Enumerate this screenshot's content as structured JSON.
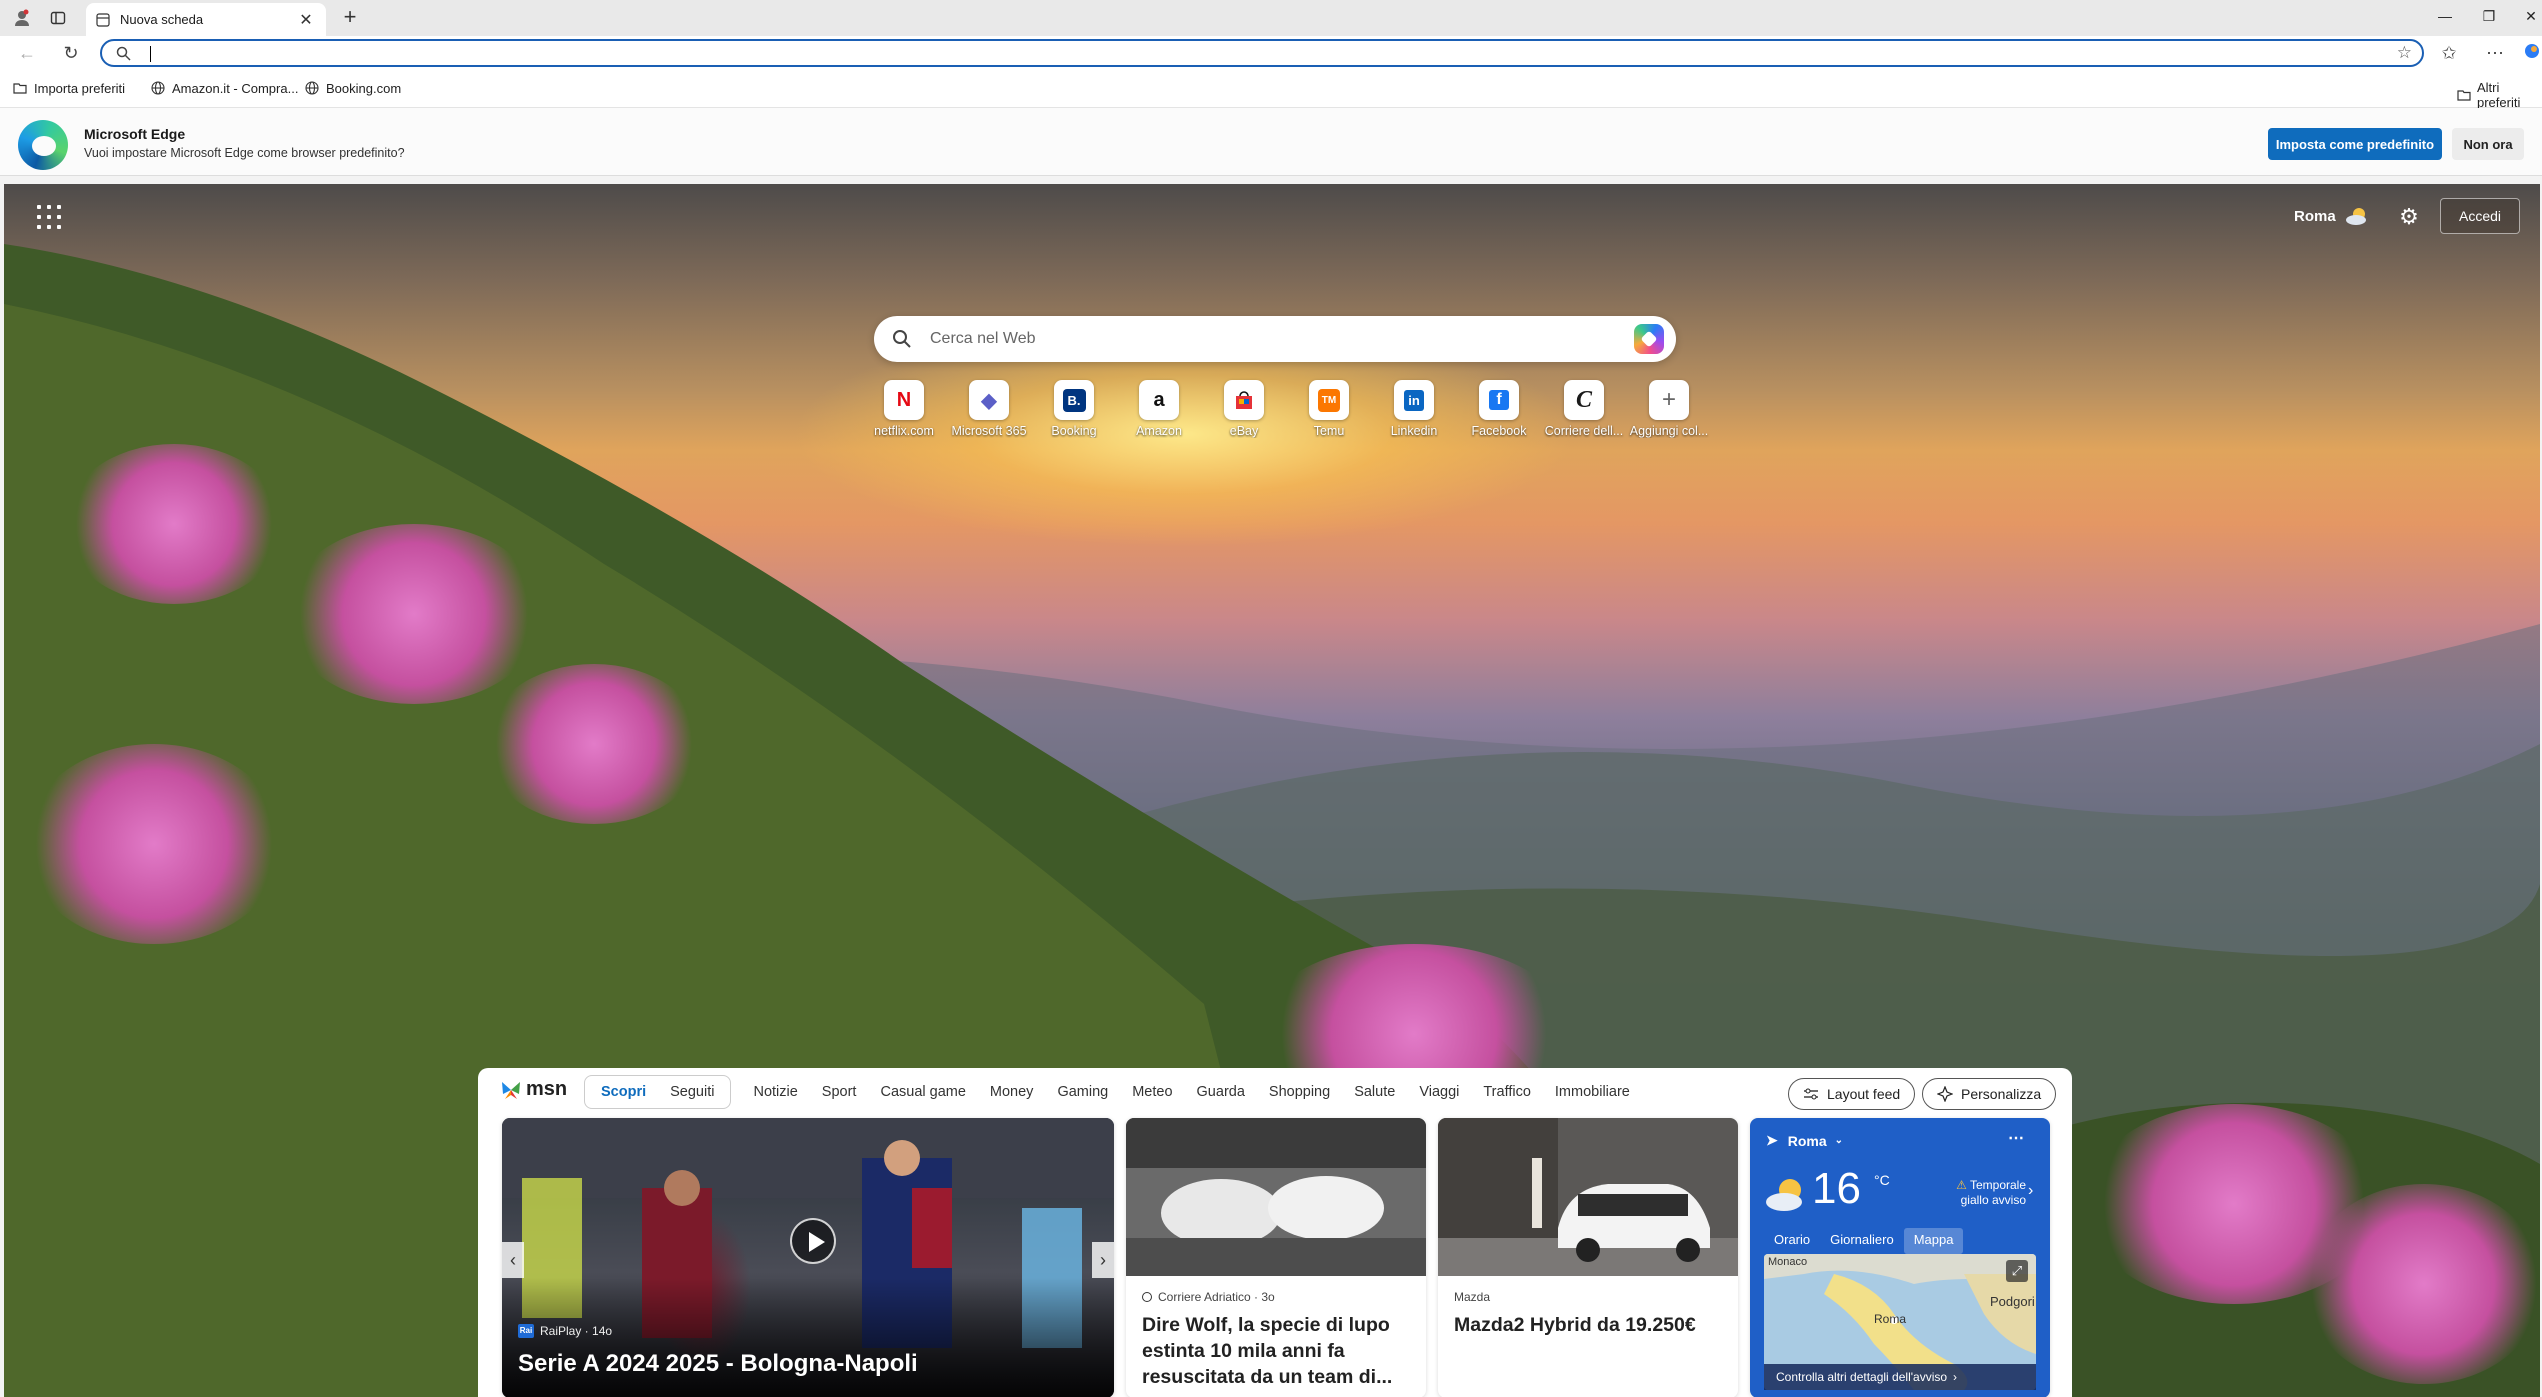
{
  "browser": {
    "tab_title": "Nuova scheda",
    "address_value": "",
    "favorites": [
      "Importa preferiti",
      "Amazon.it - Compra...",
      "Booking.com"
    ],
    "other_favorites": "Altri preferiti"
  },
  "banner": {
    "title": "Microsoft Edge",
    "text": "Vuoi impostare Microsoft Edge come browser predefinito?",
    "primary_label": "Imposta come predefinito",
    "secondary_label": "Non ora"
  },
  "ntp": {
    "location": "Roma",
    "signin_label": "Accedi",
    "search_placeholder": "Cerca nel Web",
    "tiles": [
      {
        "label": "netflix.com",
        "glyph": "N",
        "color": "#e50914"
      },
      {
        "label": "Microsoft 365",
        "glyph": "◆",
        "color": "#5b5fc7"
      },
      {
        "label": "Booking",
        "glyph": "B.",
        "color": "#003580"
      },
      {
        "label": "Amazon",
        "glyph": "a",
        "color": "#111111"
      },
      {
        "label": "eBay",
        "glyph": "🛍",
        "color": "#e53238"
      },
      {
        "label": "Temu",
        "glyph": "TM",
        "color": "#fb7701"
      },
      {
        "label": "Linkedin",
        "glyph": "in",
        "color": "#0a66c2"
      },
      {
        "label": "Facebook",
        "glyph": "f",
        "color": "#1877f2"
      },
      {
        "label": "Corriere dell...",
        "glyph": "C",
        "color": "#111111"
      },
      {
        "label": "Aggiungi col...",
        "glyph": "+",
        "color": "#666666"
      }
    ]
  },
  "feed": {
    "brand": "msn",
    "pill_tabs": [
      "Scopri",
      "Seguiti"
    ],
    "tabs": [
      "Notizie",
      "Sport",
      "Casual game",
      "Money",
      "Gaming",
      "Meteo",
      "Guarda",
      "Shopping",
      "Salute",
      "Viaggi",
      "Traffico",
      "Immobiliare"
    ],
    "layout_label": "Layout feed",
    "personalize_label": "Personalizza",
    "cards": {
      "main": {
        "source": "RaiPlay · 14o",
        "title": "Serie A 2024 2025 - Bologna-Napoli"
      },
      "wolf": {
        "source": "Corriere Adriatico · 3o",
        "title": "Dire Wolf, la specie di lupo estinta 10 mila anni fa resuscitata da un team di..."
      },
      "car": {
        "source": "Mazda",
        "title": "Mazda2 Hybrid da 19.250€"
      }
    },
    "weather": {
      "location": "Roma",
      "temperature": "16",
      "unit": "°C",
      "alert": "Temporale giallo avviso",
      "tabs": [
        "Orario",
        "Giornaliero",
        "Mappa"
      ],
      "active_tab": "Mappa",
      "map_labels": [
        "Monaco",
        "Roma",
        "Podgori"
      ],
      "footer": "Controlla altri dettagli dell'avviso"
    }
  },
  "colors": {
    "accent": "#0f6cbd",
    "weather_card": "#1f5fc7"
  }
}
